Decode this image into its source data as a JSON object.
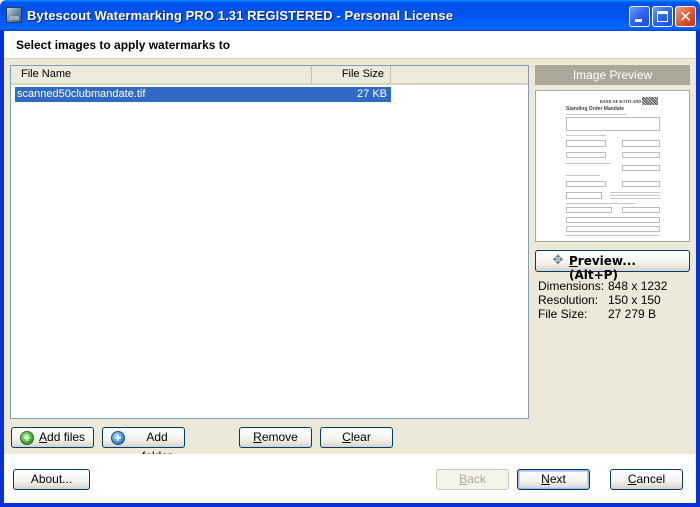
{
  "window": {
    "title": "Bytescout Watermarking PRO 1.31 REGISTERED - Personal License",
    "controls": {
      "minimize": "minimize",
      "maximize": "maximize",
      "close": "close"
    }
  },
  "header": {
    "instruction": "Select images to apply watermarks to"
  },
  "file_list": {
    "columns": [
      {
        "label": "File Name"
      },
      {
        "label": "File Size"
      }
    ],
    "rows": [
      {
        "name": "scanned50clubmandate.tif",
        "size": "27 KB",
        "selected": true
      }
    ]
  },
  "preview": {
    "title": "Image Preview",
    "thumbnail": {
      "bank_name": "BANK OF SCOTLAND",
      "doc_title": "Standing Order Mandate"
    },
    "button_label_underlined": "P",
    "button_label_rest": "review... (Alt+P)",
    "info": [
      {
        "key": "Dimensions:",
        "value": "848 x 1232"
      },
      {
        "key": "Resolution:",
        "value": "150 x 150"
      },
      {
        "key": "File Size:",
        "value": "27 279 B"
      }
    ]
  },
  "list_buttons": {
    "add_files": {
      "u": "A",
      "rest": "dd files",
      "icon": "add-green-icon"
    },
    "add_folder": {
      "pre": "Add ",
      "u": "f",
      "rest": "older",
      "icon": "add-blue-icon"
    },
    "remove": {
      "u": "R",
      "rest": "emove"
    },
    "clear": {
      "u": "C",
      "rest": "lear"
    }
  },
  "footer": {
    "about": "About...",
    "back": {
      "u": "B",
      "rest": "ack",
      "enabled": false
    },
    "next": {
      "u": "N",
      "rest": "ext"
    },
    "cancel": {
      "u": "C",
      "rest": "ancel"
    }
  }
}
